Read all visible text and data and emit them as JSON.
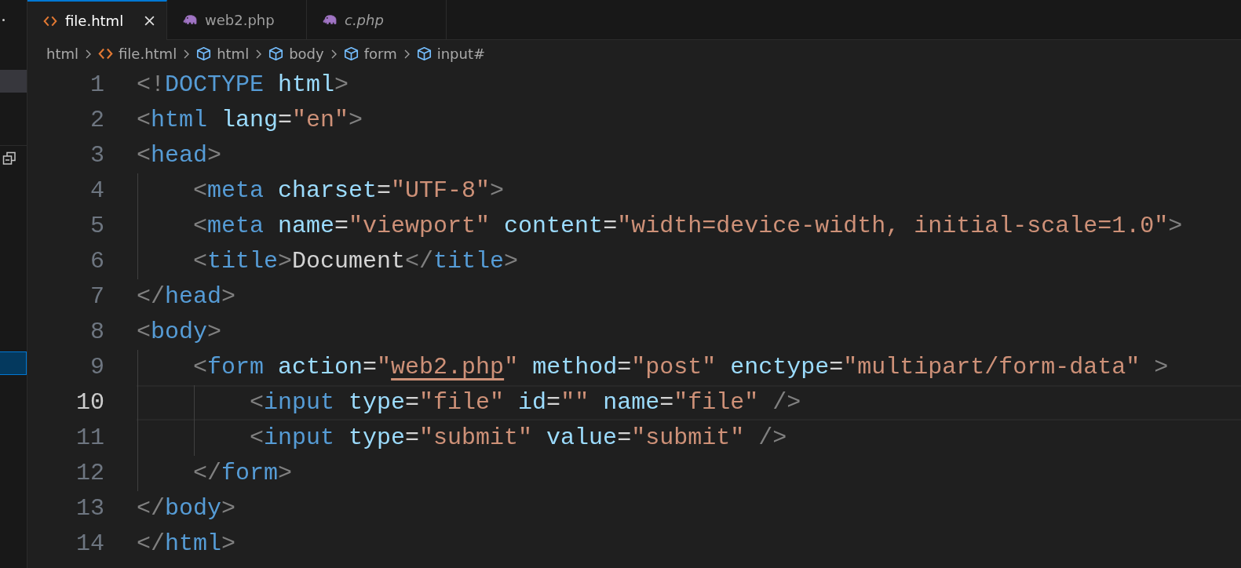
{
  "tabs": [
    {
      "label": "file.html",
      "kind": "html",
      "selected": true,
      "preview": false,
      "closable": true
    },
    {
      "label": "web2.php",
      "kind": "php",
      "selected": false,
      "preview": false,
      "closable": false
    },
    {
      "label": "c.php",
      "kind": "php",
      "selected": false,
      "preview": true,
      "closable": false
    }
  ],
  "breadcrumbs": [
    {
      "label": "html",
      "kind": "folder"
    },
    {
      "label": "file.html",
      "kind": "html"
    },
    {
      "label": "html",
      "kind": "element"
    },
    {
      "label": "body",
      "kind": "element"
    },
    {
      "label": "form",
      "kind": "element"
    },
    {
      "label": "input#",
      "kind": "element"
    }
  ],
  "explorer": {
    "hovered_row": true,
    "selected_row": true
  },
  "editor": {
    "lines": [
      {
        "number": "1",
        "current": false,
        "tokens": [
          {
            "kind": "punct",
            "text": "<!"
          },
          {
            "kind": "tag",
            "text": "DOCTYPE"
          },
          {
            "kind": "attr",
            "text": " html"
          },
          {
            "kind": "punct",
            "text": ">"
          }
        ]
      },
      {
        "number": "2",
        "current": false,
        "tokens": [
          {
            "kind": "punct",
            "text": "<"
          },
          {
            "kind": "tag",
            "text": "html"
          },
          {
            "kind": "attr",
            "text": " lang"
          },
          {
            "kind": "plain",
            "text": "="
          },
          {
            "kind": "string",
            "text": "\"en\""
          },
          {
            "kind": "punct",
            "text": ">"
          }
        ]
      },
      {
        "number": "3",
        "current": false,
        "tokens": [
          {
            "kind": "punct",
            "text": "<"
          },
          {
            "kind": "tag",
            "text": "head"
          },
          {
            "kind": "punct",
            "text": ">"
          }
        ],
        "children": [
          {
            "number": "4",
            "current": false,
            "tokens": [
              {
                "kind": "punct",
                "text": "<"
              },
              {
                "kind": "tag",
                "text": "meta"
              },
              {
                "kind": "attr",
                "text": " charset"
              },
              {
                "kind": "plain",
                "text": "="
              },
              {
                "kind": "string",
                "text": "\"UTF-8\""
              },
              {
                "kind": "punct",
                "text": ">"
              }
            ]
          },
          {
            "number": "5",
            "current": false,
            "tokens": [
              {
                "kind": "punct",
                "text": "<"
              },
              {
                "kind": "tag",
                "text": "meta"
              },
              {
                "kind": "attr",
                "text": " name"
              },
              {
                "kind": "plain",
                "text": "="
              },
              {
                "kind": "string",
                "text": "\"viewport\""
              },
              {
                "kind": "attr",
                "text": " content"
              },
              {
                "kind": "plain",
                "text": "="
              },
              {
                "kind": "string",
                "text": "\"width=device-width, initial-scale=1.0\""
              },
              {
                "kind": "punct",
                "text": ">"
              }
            ]
          },
          {
            "number": "6",
            "current": false,
            "tokens": [
              {
                "kind": "punct",
                "text": "<"
              },
              {
                "kind": "tag",
                "text": "title"
              },
              {
                "kind": "punct",
                "text": ">"
              },
              {
                "kind": "plain",
                "text": "Document"
              },
              {
                "kind": "punct",
                "text": "</"
              },
              {
                "kind": "tag",
                "text": "title"
              },
              {
                "kind": "punct",
                "text": ">"
              }
            ]
          }
        ]
      },
      {
        "number": "7",
        "current": false,
        "tokens": [
          {
            "kind": "punct",
            "text": "</"
          },
          {
            "kind": "tag",
            "text": "head"
          },
          {
            "kind": "punct",
            "text": ">"
          }
        ]
      },
      {
        "number": "8",
        "current": false,
        "tokens": [
          {
            "kind": "punct",
            "text": "<"
          },
          {
            "kind": "tag",
            "text": "body"
          },
          {
            "kind": "punct",
            "text": ">"
          }
        ],
        "children": [
          {
            "number": "9",
            "current": false,
            "tokens": [
              {
                "kind": "punct",
                "text": "<"
              },
              {
                "kind": "tag",
                "text": "form"
              },
              {
                "kind": "attr",
                "text": " action"
              },
              {
                "kind": "plain",
                "text": "="
              },
              {
                "kind": "string",
                "text": "\""
              },
              {
                "kind": "link",
                "text": "web2.php"
              },
              {
                "kind": "string",
                "text": "\""
              },
              {
                "kind": "attr",
                "text": " method"
              },
              {
                "kind": "plain",
                "text": "="
              },
              {
                "kind": "string",
                "text": "\"post\""
              },
              {
                "kind": "attr",
                "text": " enctype"
              },
              {
                "kind": "plain",
                "text": "="
              },
              {
                "kind": "string",
                "text": "\"multipart/form-data\""
              },
              {
                "kind": "punct",
                "text": " >"
              }
            ],
            "children": [
              {
                "number": "10",
                "current": true,
                "tokens": [
                  {
                    "kind": "punct",
                    "text": "<"
                  },
                  {
                    "kind": "tag",
                    "text": "input"
                  },
                  {
                    "kind": "attr",
                    "text": " type"
                  },
                  {
                    "kind": "plain",
                    "text": "="
                  },
                  {
                    "kind": "string",
                    "text": "\"file\""
                  },
                  {
                    "kind": "attr",
                    "text": " id"
                  },
                  {
                    "kind": "plain",
                    "text": "="
                  },
                  {
                    "kind": "string",
                    "text": "\"\""
                  },
                  {
                    "kind": "attr",
                    "text": " name"
                  },
                  {
                    "kind": "plain",
                    "text": "="
                  },
                  {
                    "kind": "string",
                    "text": "\"file\""
                  },
                  {
                    "kind": "punct",
                    "text": " />"
                  }
                ]
              },
              {
                "number": "11",
                "current": false,
                "tokens": [
                  {
                    "kind": "punct",
                    "text": "<"
                  },
                  {
                    "kind": "tag",
                    "text": "input"
                  },
                  {
                    "kind": "attr",
                    "text": " type"
                  },
                  {
                    "kind": "plain",
                    "text": "="
                  },
                  {
                    "kind": "string",
                    "text": "\"submit\""
                  },
                  {
                    "kind": "attr",
                    "text": " value"
                  },
                  {
                    "kind": "plain",
                    "text": "="
                  },
                  {
                    "kind": "string",
                    "text": "\"submit\""
                  },
                  {
                    "kind": "punct",
                    "text": " />"
                  }
                ]
              }
            ]
          },
          {
            "number": "12",
            "current": false,
            "tokens": [
              {
                "kind": "punct",
                "text": "</"
              },
              {
                "kind": "tag",
                "text": "form"
              },
              {
                "kind": "punct",
                "text": ">"
              }
            ]
          }
        ]
      },
      {
        "number": "13",
        "current": false,
        "tokens": [
          {
            "kind": "punct",
            "text": "</"
          },
          {
            "kind": "tag",
            "text": "body"
          },
          {
            "kind": "punct",
            "text": ">"
          }
        ]
      },
      {
        "number": "14",
        "current": false,
        "tokens": [
          {
            "kind": "punct",
            "text": "</"
          },
          {
            "kind": "tag",
            "text": "html"
          },
          {
            "kind": "punct",
            "text": ">"
          }
        ]
      }
    ]
  }
}
